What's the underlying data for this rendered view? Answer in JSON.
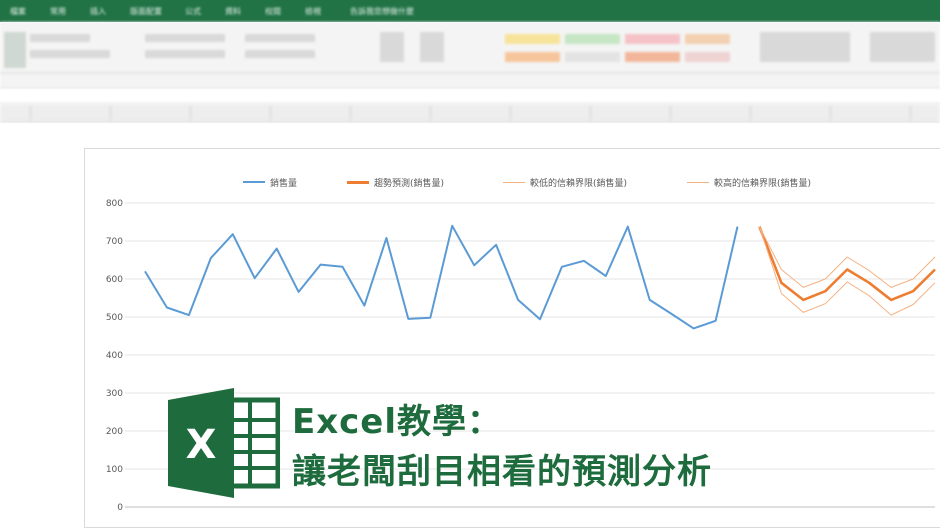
{
  "window": {
    "menu_tabs": [
      "檔案",
      "常用",
      "插入",
      "版面配置",
      "公式",
      "資料",
      "校閱",
      "檢視",
      "告訴我您想做什麼"
    ]
  },
  "colors": {
    "excel_green": "#217346",
    "sales_line": "#5b9bd5",
    "forecast_line": "#ed7d31",
    "bound_line": "#f4b183",
    "banner_text": "#1e6b3e"
  },
  "chart_data": {
    "type": "line",
    "title": "",
    "xlabel": "",
    "ylabel": "",
    "ylim": [
      0,
      800
    ],
    "yticks": [
      "0",
      "100",
      "200",
      "300",
      "400",
      "500",
      "600",
      "700",
      "800"
    ],
    "grid": "horizontal",
    "legend_position": "top",
    "legend": [
      "銷售量",
      "趨勢預測(銷售量)",
      "較低的信賴界限(銷售量)",
      "較高的信賴界限(銷售量)"
    ],
    "x": [
      1,
      2,
      3,
      4,
      5,
      6,
      7,
      8,
      9,
      10,
      11,
      12,
      13,
      14,
      15,
      16,
      17,
      18,
      19,
      20,
      21,
      22,
      23,
      24,
      25,
      26,
      27,
      28,
      29,
      30,
      31,
      32,
      33,
      34,
      35,
      36,
      37
    ],
    "series": [
      {
        "name": "銷售量",
        "color": "#5b9bd5",
        "x": [
          1,
          2,
          3,
          4,
          5,
          6,
          7,
          8,
          9,
          10,
          11,
          12,
          13,
          14,
          15,
          16,
          17,
          18,
          19,
          20,
          21,
          22,
          23,
          24,
          25,
          26,
          27,
          28,
          29,
          30
        ],
        "values": [
          620,
          525,
          505,
          655,
          718,
          602,
          680,
          566,
          638,
          632,
          530,
          708,
          495,
          498,
          740,
          636,
          690,
          545,
          494,
          632,
          648,
          608,
          738,
          545,
          508,
          470,
          490,
          738,
          null,
          null
        ]
      },
      {
        "name": "趨勢預測(銷售量)",
        "color": "#ed7d31",
        "x": [
          29,
          30,
          31,
          32,
          33,
          34,
          35,
          36,
          37
        ],
        "values": [
          738,
          590,
          545,
          568,
          625,
          590,
          545,
          568,
          625
        ]
      },
      {
        "name": "較低的信賴界限(銷售量)",
        "color": "#f4b183",
        "x": [
          29,
          30,
          31,
          32,
          33,
          34,
          35,
          36,
          37
        ],
        "values": [
          738,
          562,
          512,
          535,
          592,
          556,
          505,
          533,
          590
        ]
      },
      {
        "name": "較高的信賴界限(銷售量)",
        "color": "#f4b183",
        "x": [
          29,
          30,
          31,
          32,
          33,
          34,
          35,
          36,
          37
        ],
        "values": [
          738,
          625,
          578,
          600,
          658,
          622,
          578,
          600,
          658
        ]
      }
    ]
  },
  "banner": {
    "line1": "Excel教學：",
    "line2": "讓老闆刮目相看的預測分析",
    "logo_letter": "X"
  }
}
